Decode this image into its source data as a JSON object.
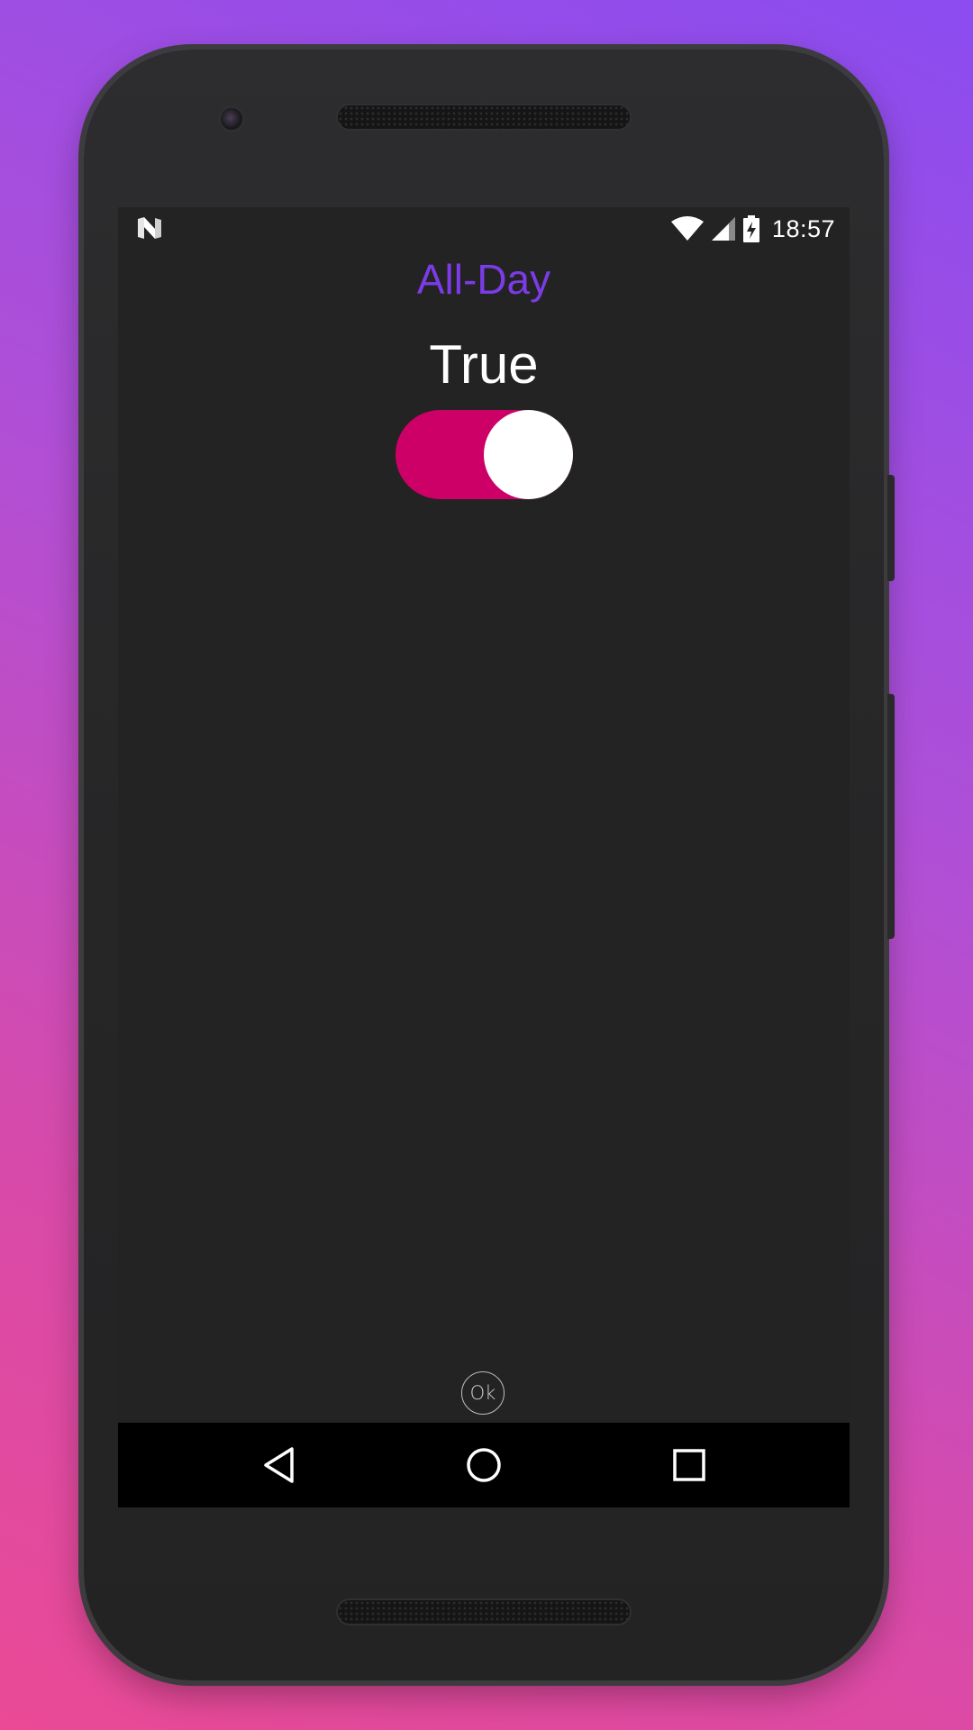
{
  "status_bar": {
    "time": "18:57",
    "icons": [
      "android-n-icon",
      "wifi-icon",
      "cellular-signal-icon",
      "battery-charging-icon"
    ]
  },
  "title": "All-Day",
  "value_text": "True",
  "toggle": {
    "checked": true,
    "track_color": "#cc0066",
    "thumb_color": "#ffffff"
  },
  "ok_button": {
    "label": "Ok"
  },
  "nav_bar": {
    "icons": [
      "back-icon",
      "home-icon",
      "recents-icon"
    ]
  },
  "colors": {
    "accent": "#7b3be6",
    "screen_background": "#232323",
    "nav_background": "#000000"
  }
}
